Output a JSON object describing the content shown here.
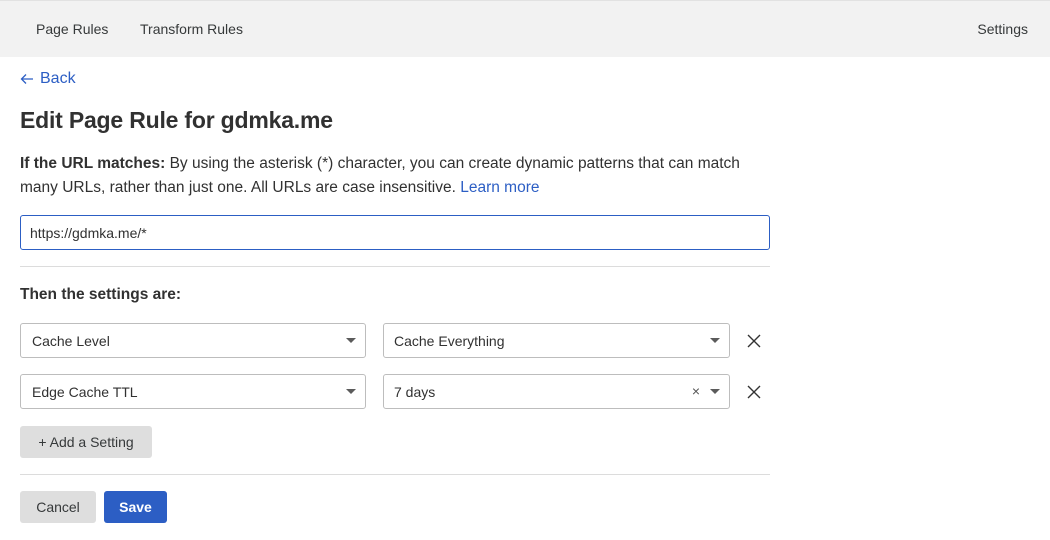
{
  "nav": {
    "tabs": [
      "Page Rules",
      "Transform Rules"
    ],
    "settings_label": "Settings"
  },
  "back_label": "Back",
  "page_title": "Edit Page Rule for gdmka.me",
  "description": {
    "lead": "If the URL matches:",
    "body": " By using the asterisk (*) character, you can create dynamic patterns that can match many URLs, rather than just one. All URLs are case insensitive. ",
    "link": "Learn more"
  },
  "url_input": {
    "value": "https://gdmka.me/*"
  },
  "settings_heading": "Then the settings are:",
  "settings": [
    {
      "setting": "Cache Level",
      "value": "Cache Everything",
      "clearable": false
    },
    {
      "setting": "Edge Cache TTL",
      "value": "7 days",
      "clearable": true
    }
  ],
  "clear_glyph": "×",
  "add_setting_label": "+ Add a Setting",
  "cancel_label": "Cancel",
  "save_label": "Save",
  "colors": {
    "accent": "#2c5ec4",
    "nav_bg": "#f2f2f2",
    "button_gray": "#dedede"
  }
}
